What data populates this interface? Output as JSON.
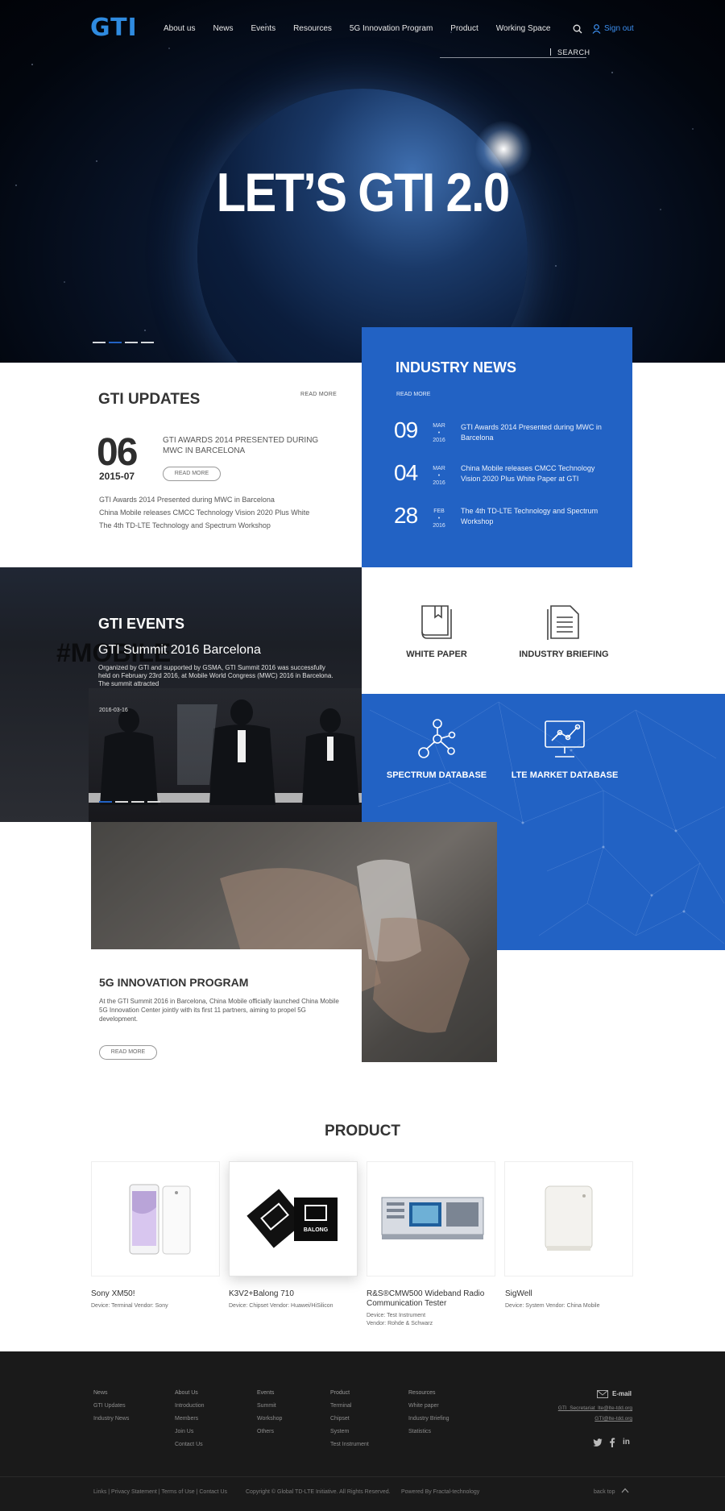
{
  "header": {
    "logo": "GTI",
    "nav": [
      "About us",
      "News",
      "Events",
      "Resources",
      "5G Innovation Program",
      "Product",
      "Working Space"
    ],
    "search_label": "SEARCH",
    "signout": "Sign out"
  },
  "hero": {
    "title": "LET’S GTI 2.0",
    "slides": 4,
    "active_slide": 2
  },
  "updates": {
    "title": "GTI UPDATES",
    "read_more": "READ MORE",
    "day": "06",
    "month_year": "2015-07",
    "headline": "GTI AWARDS 2014 PRESENTED DURING MWC IN BARCELONA",
    "button": "READ MORE",
    "items": [
      "GTI Awards 2014 Presented during MWC in Barcelona",
      "China Mobile releases CMCC Technology Vision 2020 Plus White",
      "The 4th TD-LTE Technology and Spectrum Workshop"
    ]
  },
  "industry_news": {
    "title": "INDUSTRY NEWS",
    "read_more": "READ MORE",
    "items": [
      {
        "day": "09",
        "month": "MAR",
        "year": "2016",
        "text": "GTI Awards 2014 Presented during MWC in Barcelona"
      },
      {
        "day": "04",
        "month": "MAR",
        "year": "2016",
        "text": "China Mobile releases CMCC Technology Vision 2020 Plus White Paper at GTI"
      },
      {
        "day": "28",
        "month": "FEB",
        "year": "2016",
        "text": "The 4th TD-LTE Technology and Spectrum Workshop"
      }
    ]
  },
  "events": {
    "title": "GTI EVENTS",
    "bg_text": "#MOBILE",
    "subtitle": "GTI Summit 2016 Barcelona",
    "description": "Organized by GTI and supported by GSMA, GTI Summit 2016 was successfully held on February 23rd 2016, at Mobile World Congress (MWC) 2016 in Barcelona. The summit attracted",
    "date": "2016-03-16",
    "slides": 4,
    "active_slide": 1
  },
  "resources": {
    "white_paper": "WHITE PAPER",
    "industry_briefing": "INDUSTRY BRIEFING",
    "spectrum_database": "SPECTRUM DATABASE",
    "lte_market_database": "LTE MARKET DATABASE"
  },
  "innovation": {
    "title": "5G  INNOVATION PROGRAM",
    "description": "At the GTI Summit 2016 in Barcelona, China Mobile officially launched China Mobile 5G Innovation Center jointly with its first 11 partners, aiming to propel 5G development.",
    "button": "READ MORE"
  },
  "product": {
    "title": "PRODUCT",
    "items": [
      {
        "name": "Sony XM50!",
        "meta": [
          "Device: Terminal   Vendor: Sony"
        ]
      },
      {
        "name": "K3V2+Balong 710",
        "meta": [
          "Device: Chipset   Vendor: Huawei/HiSilicon"
        ]
      },
      {
        "name": "R&S®CMW500 Wideband Radio Communication Tester",
        "meta": [
          "Device: Test Instrument",
          "Vendor: Rohde & Schwarz"
        ]
      },
      {
        "name": "SigWell",
        "meta": [
          "Device: System   Vendor: China Mobile"
        ]
      }
    ],
    "chip_brand": "BALONG"
  },
  "footer": {
    "columns": [
      [
        "News",
        "GTI Updates",
        "Industry News"
      ],
      [
        "About Us",
        "Introduction",
        "Members",
        "Join Us",
        "Contact Us"
      ],
      [
        "Events",
        "Summit",
        "Workshop",
        "Others"
      ],
      [
        "Product",
        "Terminal",
        "Chipset",
        "System",
        "Test Instrument"
      ],
      [
        "Resources",
        "White paper",
        "Industry Briefing",
        "Statistics"
      ]
    ],
    "email_label": "E-mail",
    "emails": [
      "GTI_Secretariat_lte@lte-tdd.org",
      "GTI@lte-tdd.org"
    ],
    "social": [
      "twitter-icon",
      "facebook-icon",
      "linkedin-icon"
    ],
    "bottom_links": "Links  |  Privacy Statement  |  Terms of Use  |  Contact Us",
    "copyright": "Copyright © Global TD-LTE Initiative. All Rights Reserved.",
    "powered": "Powered By Fractal-technology",
    "back_top": "back top"
  },
  "colors": {
    "brand_blue": "#2262c4",
    "logo_blue": "#2f8be0",
    "footer_bg": "#1a1a1a"
  }
}
